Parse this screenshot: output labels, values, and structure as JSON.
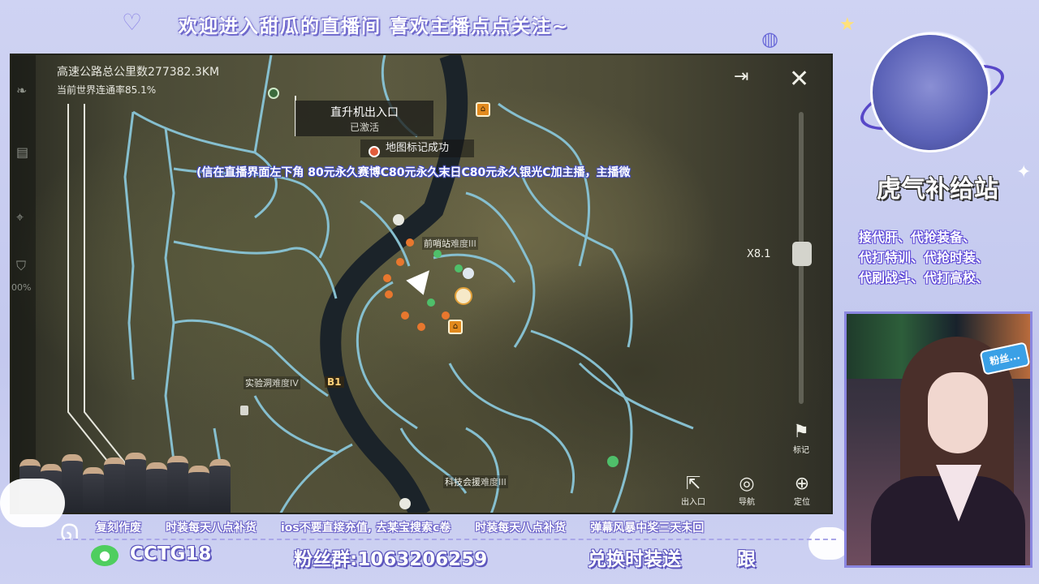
{
  "banner": {
    "text": "欢迎进入甜瓜的直播间 喜欢主播点点关注~"
  },
  "map": {
    "road_total": "高速公路总公里数277382.3KM",
    "connectivity": "当前世界连通率85.1%",
    "left_rail_percent": "00%",
    "heli_popup_title": "直升机出入口",
    "heli_popup_status": "已激活",
    "toast": "地图标记成功",
    "scroll_message": "(信在直播界面左下角 80元永久赛博C80元永久末日C80元永久银光C加主播，主播微",
    "zoom_label": "X8.1",
    "pois": [
      {
        "name": "前哨站",
        "difficulty": "难度III"
      },
      {
        "name": "实验洞",
        "difficulty": "难度IV"
      },
      {
        "name": "科技会援",
        "difficulty": "难度III"
      }
    ],
    "b1_label": "B1",
    "buttons": {
      "mark": "标记",
      "entrance": "出入口",
      "navigate": "导航",
      "locate": "定位"
    },
    "icons": {
      "close": "close-icon",
      "exit": "exit-icon"
    }
  },
  "ticker": [
    "复刻作废",
    "时装每天八点补货",
    "ios不要直接充值, 去某宝搜索c卷",
    "时装每天八点补货",
    "弹幕风暴中奖三天未回"
  ],
  "bottom": {
    "wechat_id": "CCTG18",
    "fan_group": "粉丝群:1063206259",
    "exchange": "兑换时装送",
    "follow": "跟"
  },
  "shop": {
    "title": "虎气补给站",
    "services": [
      "接代肝、代抢装备、",
      "代打特训、代抢时装、",
      "代刷战斗、代打高校、"
    ]
  },
  "camera": {
    "badge": "粉丝..."
  },
  "colors": {
    "frame_bg": "#c9cdef",
    "road_line": "#7fb8c8",
    "accent_purple": "#6b62c8",
    "building_orange": "#e28a1e"
  }
}
